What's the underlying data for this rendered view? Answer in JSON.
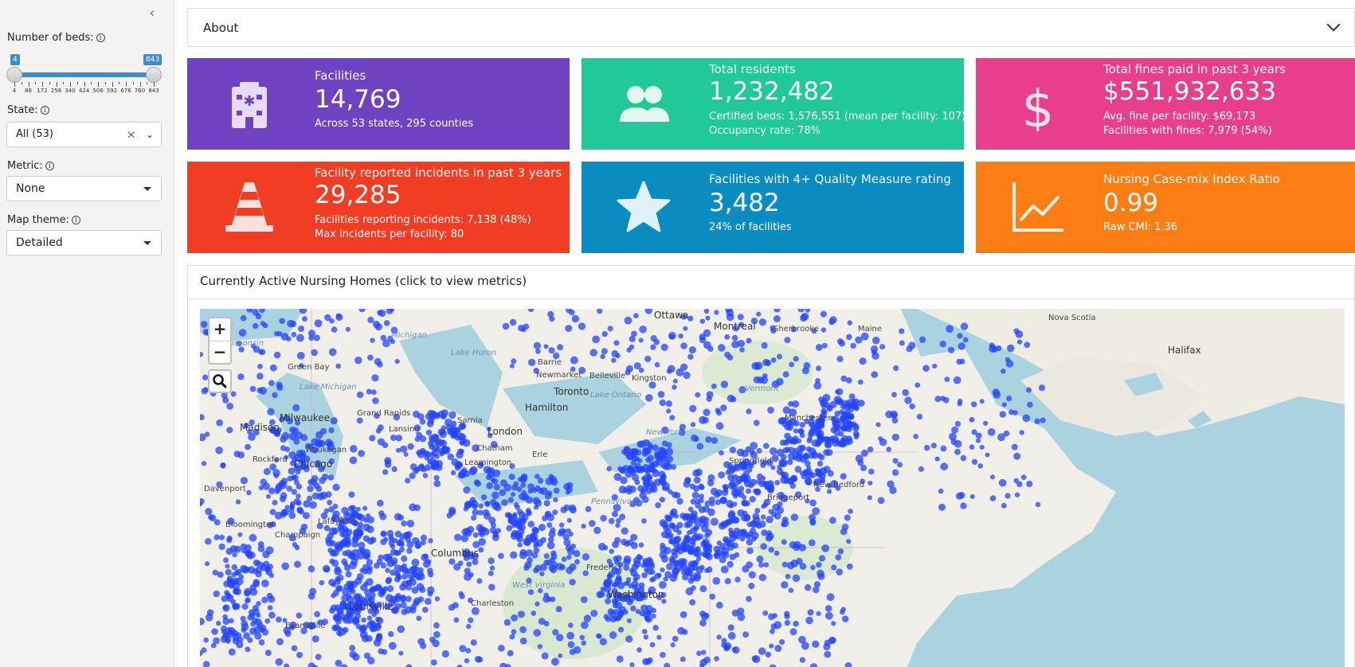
{
  "sidebar": {
    "collapse_icon": "chevron-left-icon",
    "beds_label": "Number of beds:",
    "beds_min": "4",
    "beds_max": "843",
    "beds_ticks": [
      "4",
      "88",
      "172",
      "256",
      "340",
      "424",
      "508",
      "592",
      "676",
      "760",
      "843"
    ],
    "state_label": "State:",
    "state_value": "All (53)",
    "metric_label": "Metric:",
    "metric_value": "None",
    "theme_label": "Map theme:",
    "theme_value": "Detailed"
  },
  "about": {
    "title": "About"
  },
  "cards": [
    {
      "title": "Facilities",
      "value": "14,769",
      "sub1": "Across 53 states, 295 counties",
      "sub2": "",
      "color": "#6f42c1",
      "icon": "hospital-icon"
    },
    {
      "title": "Total residents",
      "value": "1,232,482",
      "sub1": "Certified beds: 1,576,551 (mean per facility: 107)",
      "sub2": "Occupancy rate: 78%",
      "color": "#20c997",
      "icon": "users-icon"
    },
    {
      "title": "Total fines paid in past 3 years",
      "value": "$551,932,633",
      "sub1": "Avg. fine per facility: $69,173",
      "sub2": "Facilities with fines: 7,979 (54%)",
      "color": "#e83e8c",
      "icon": "dollar-icon"
    },
    {
      "title": "Facility reported incidents in past 3 years",
      "value": "29,285",
      "sub1": "Facilities reporting incidents: 7,138 (48%)",
      "sub2": "Max incidents per facility: 80",
      "color": "#f03d23",
      "icon": "traffic-cone-icon"
    },
    {
      "title": "Facilities with 4+ Quality Measure rating",
      "value": "3,482",
      "sub1": "24% of facilities",
      "sub2": "",
      "color": "#0a8cc0",
      "icon": "star-icon"
    },
    {
      "title": "Nursing Case-mix Index Ratio",
      "value": "0.99",
      "sub1": "Raw CMI: 1.36",
      "sub2": "",
      "color": "#fd7e14",
      "icon": "line-chart-icon"
    }
  ],
  "map": {
    "title": "Currently Active Nursing Homes (click to view metrics)",
    "zoom_in": "+",
    "zoom_out": "−",
    "labels": {
      "ottawa": "Ottawa",
      "montreal": "Montreal",
      "sherbrooke": "Sherbrooke",
      "maine": "Maine",
      "nova_scotia": "Nova Scotia",
      "halifax": "Halifax",
      "michigan": "Michigan",
      "lake_huron": "Lake Huron",
      "barrie": "Barrie",
      "newmarket": "Newmarket",
      "belleville": "Belleville",
      "kingston": "Kingston",
      "toronto": "Toronto",
      "lake_ontario": "Lake Ontario",
      "hamilton": "Hamilton",
      "vermont": "Vermont",
      "green_bay": "Green Bay",
      "lake_michigan": "Lake Michigan",
      "grand_rapids": "Grand Rapids",
      "sarnia": "Sarnia",
      "lansing": "Lansing",
      "london": "London",
      "chatham": "Chatham",
      "milwaukee": "Milwaukee",
      "madison": "Madison",
      "waukegan": "Waukegan",
      "rockford": "Rockford",
      "chicago": "Chicago",
      "leamington": "Leamington",
      "erie": "Erie",
      "new_york": "New York",
      "springfield": "Springfield",
      "bridgeport": "Bridgeport",
      "new_bedford": "New Bedford",
      "davenport": "Davenport",
      "bloomington": "Bloomington",
      "champaign": "Champaign",
      "lafayette": "Lafayette",
      "columbus": "Columbus",
      "pennsylvania": "Pennsylvania",
      "louisville": "Louisville",
      "charleston": "Charleston",
      "west_virginia": "West Virginia",
      "frederick": "Frederick",
      "washington": "Washington",
      "wisconsin": "Wisconsin",
      "evansville": "Evansville",
      "manchester": "Manchester"
    }
  }
}
